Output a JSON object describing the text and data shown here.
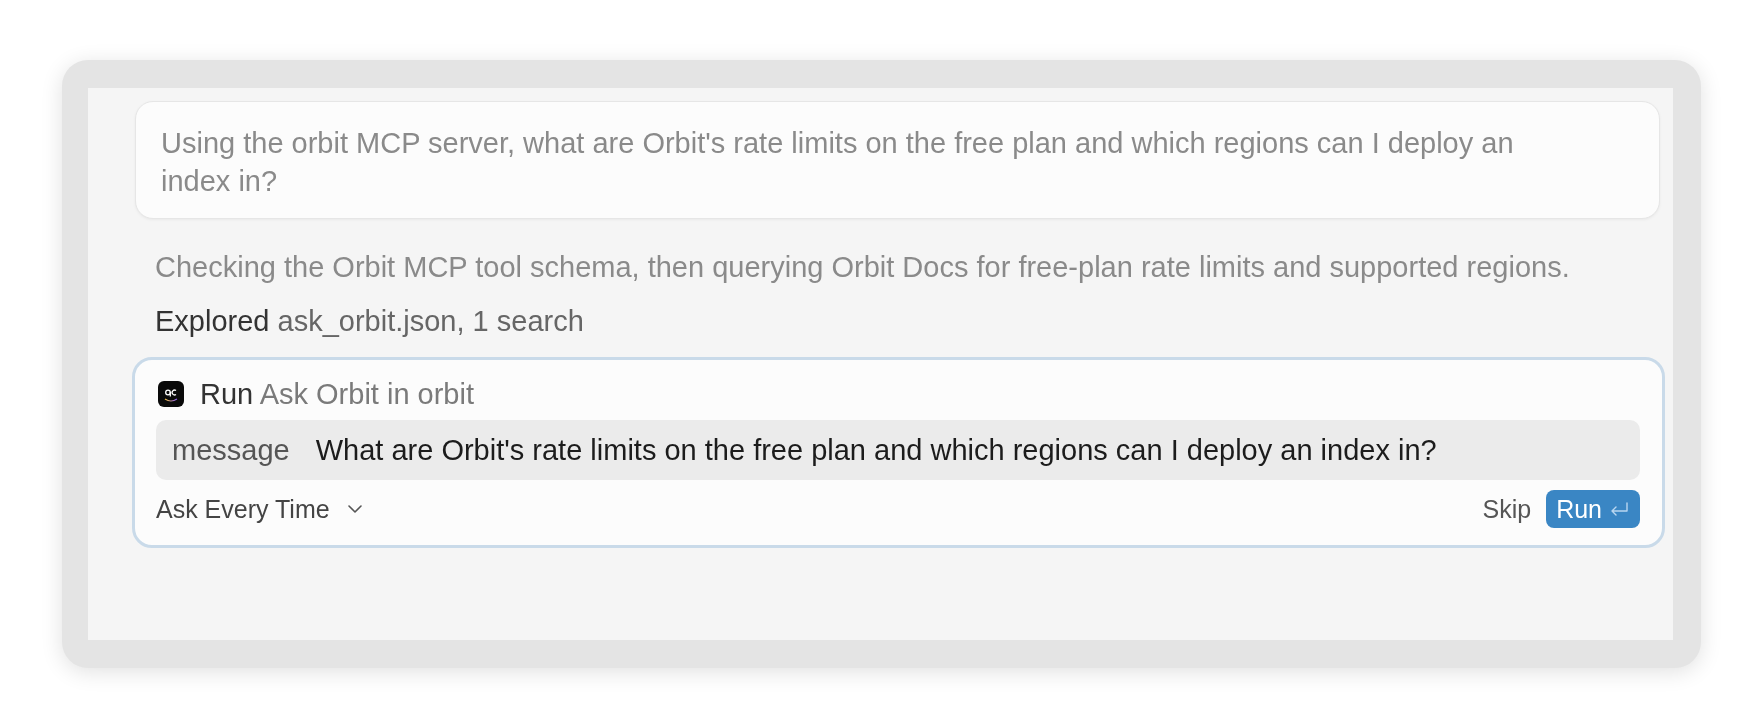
{
  "user_message": {
    "text": "Using the orbit MCP server, what are Orbit's rate limits on the free plan and which regions can I deploy an index in?"
  },
  "status_text": "Checking the Orbit MCP tool schema, then querying Orbit Docs for free-plan rate limits and supported regions.",
  "activity": {
    "label": "Explored",
    "detail": "ask_orbit.json, 1 search"
  },
  "tool_call": {
    "action": "Run",
    "tool": "Ask Orbit in orbit",
    "arguments": [
      {
        "name": "message",
        "value": "What are Orbit's rate limits on the free plan and which regions can I deploy an index in?"
      }
    ],
    "approval_mode": "Ask Every Time",
    "buttons": [
      {
        "label": "Skip",
        "kind": "secondary"
      },
      {
        "label": "Run",
        "kind": "primary"
      }
    ]
  }
}
